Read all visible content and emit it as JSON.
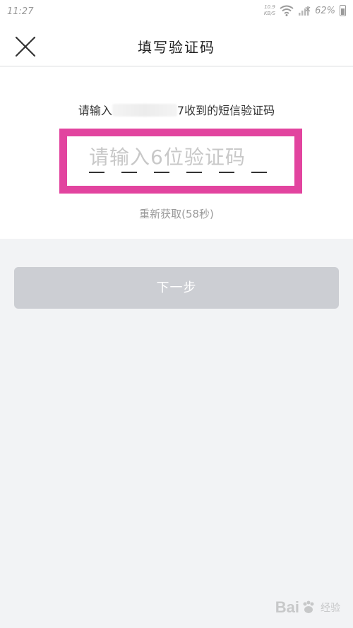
{
  "status_bar": {
    "time": "11:27",
    "net_speed_value": "10.9",
    "net_speed_unit": "KB/S",
    "battery": "62%"
  },
  "header": {
    "title": "填写验证码",
    "close_icon": "close-icon"
  },
  "verification": {
    "hint_prefix": "请输入",
    "hint_suffix": "7收到的短信验证码",
    "placeholder": "请输入6位验证码",
    "slots": 6,
    "resend": "重新获取(58秒)"
  },
  "actions": {
    "next_label": "下一步"
  },
  "watermark": {
    "brand_a": "Bai",
    "brand_b": "经验"
  },
  "colors": {
    "highlight": "#e2449f",
    "button_disabled": "#ccced3",
    "page_bg": "#f2f3f5"
  }
}
